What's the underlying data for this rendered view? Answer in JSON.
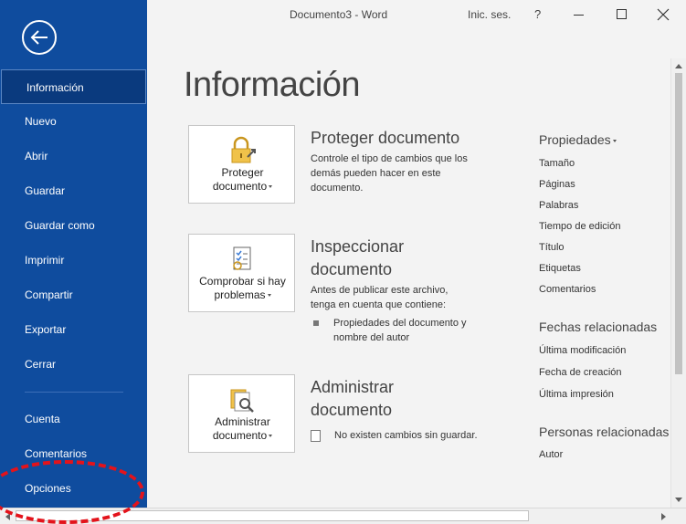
{
  "titlebar": {
    "title": "Documento3  -  Word",
    "login": "Inic. ses.",
    "help": "?"
  },
  "sidebar": {
    "items": [
      {
        "label": "Información"
      },
      {
        "label": "Nuevo"
      },
      {
        "label": "Abrir"
      },
      {
        "label": "Guardar"
      },
      {
        "label": "Guardar como"
      },
      {
        "label": "Imprimir"
      },
      {
        "label": "Compartir"
      },
      {
        "label": "Exportar"
      },
      {
        "label": "Cerrar"
      },
      {
        "label": "Cuenta"
      },
      {
        "label": "Comentarios"
      },
      {
        "label": "Opciones"
      }
    ]
  },
  "main": {
    "title": "Información",
    "sections": {
      "protect": {
        "card_line1": "Proteger",
        "card_line2": "documento",
        "title": "Proteger documento",
        "desc": "Controle el tipo de cambios que los demás pueden hacer en este documento."
      },
      "inspect": {
        "card_line1": "Comprobar si hay",
        "card_line2": "problemas",
        "title_line1": "Inspeccionar",
        "title_line2": "documento",
        "desc": "Antes de publicar este archivo, tenga en cuenta que contiene:",
        "bullet": "Propiedades del documento y nombre del autor"
      },
      "manage": {
        "card_line1": "Administrar",
        "card_line2": "documento",
        "title_line1": "Administrar",
        "title_line2": "documento",
        "note": "No existen cambios sin guardar."
      }
    },
    "properties": {
      "heading": "Propiedades",
      "items": [
        "Tamaño",
        "Páginas",
        "Palabras",
        "Tiempo de edición",
        "Título",
        "Etiquetas",
        "Comentarios"
      ],
      "dates_heading": "Fechas relacionadas",
      "dates": [
        "Última modificación",
        "Fecha de creación",
        "Última impresión"
      ],
      "people_heading": "Personas relacionadas",
      "people": [
        "Autor"
      ]
    }
  },
  "colors": {
    "sidebar": "#0f4c9e",
    "sidebar_active": "#0a3a7e",
    "highlight": "#e3131b"
  }
}
